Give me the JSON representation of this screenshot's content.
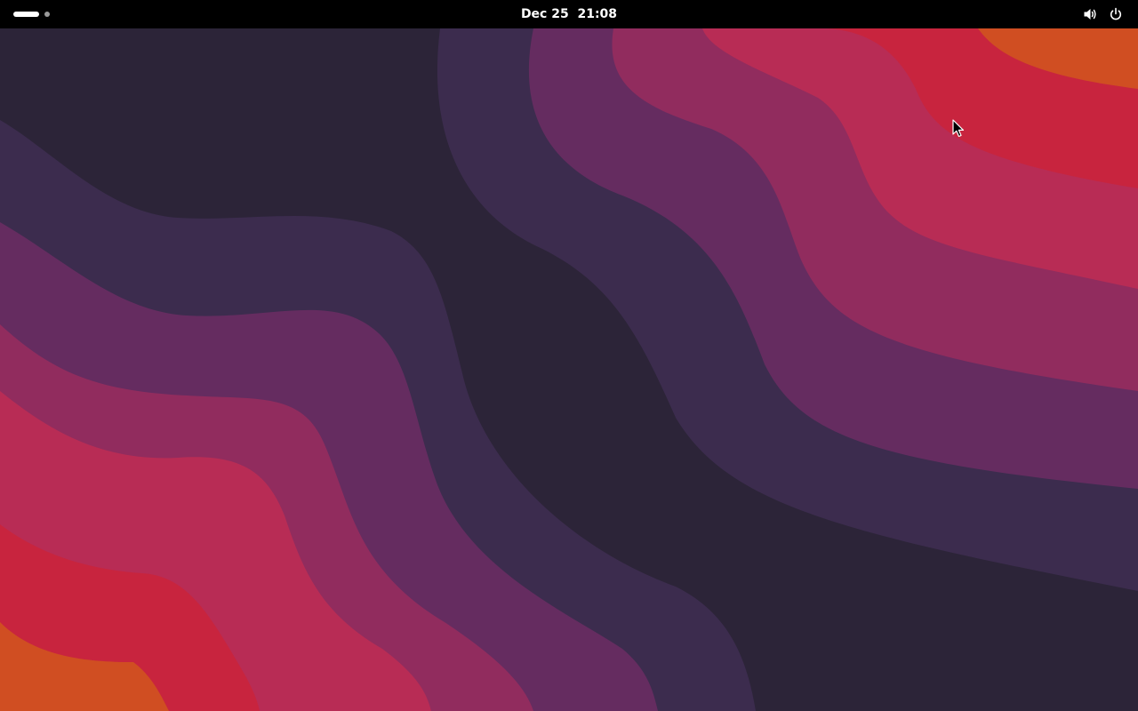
{
  "top_bar": {
    "date": "Dec 25",
    "time": "21:08",
    "background": "#000000",
    "foreground": "#ffffff"
  },
  "workspace_indicator": {
    "active_workspace": 1,
    "workspace_count": 2
  },
  "system_tray": {
    "icons": [
      "volume-icon",
      "power-icon"
    ]
  },
  "wallpaper": {
    "colors": [
      "#2c2438",
      "#3c2c4e",
      "#652c60",
      "#912c5e",
      "#b82c55",
      "#c8243e",
      "#d04e22"
    ]
  }
}
